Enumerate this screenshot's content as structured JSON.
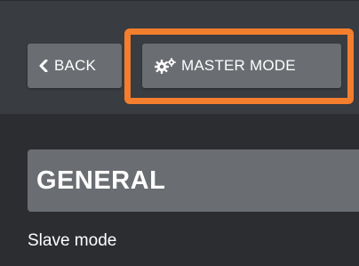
{
  "toolbar": {
    "back_label": "BACK",
    "master_mode_label": "MASTER MODE"
  },
  "icons": {
    "back": "chevron-left-icon",
    "master_mode": "gears-icon"
  },
  "section": {
    "title": "GENERAL",
    "first_setting_label": "Slave mode"
  },
  "colors": {
    "highlight": "#f37e2d",
    "button_bg": "#6a6d71",
    "toolbar_bg": "#393c41",
    "page_bg": "#2b2d31"
  }
}
